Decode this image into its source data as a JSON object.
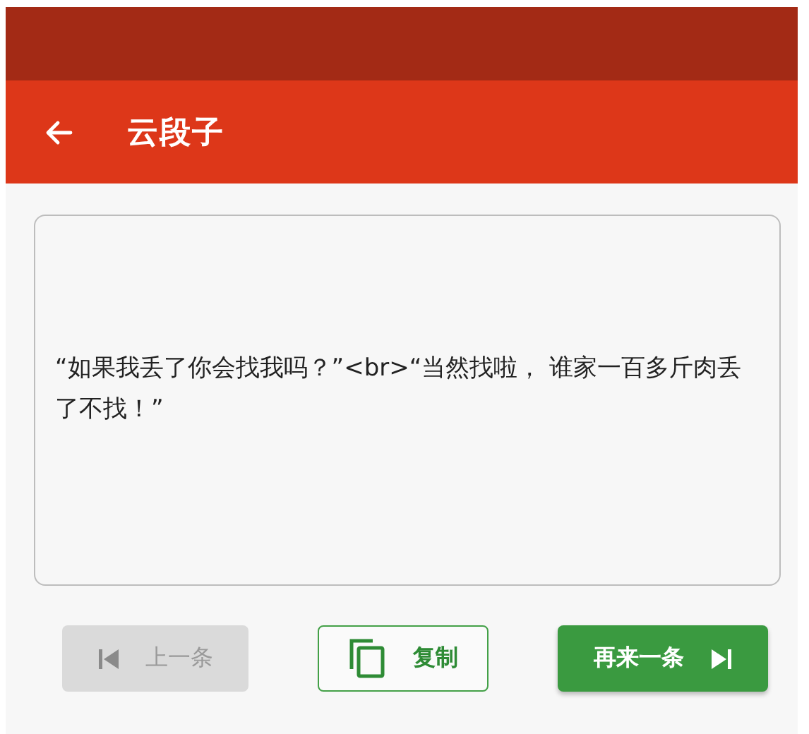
{
  "app_bar": {
    "title": "云段子"
  },
  "joke": {
    "text": "“如果我丢了你会找我吗？”<br>“当然找啦， 谁家一百多斤肉丢了不找！”"
  },
  "buttons": [
    {
      "kind": "previous",
      "label": "上一条",
      "disabled": true
    },
    {
      "kind": "copy",
      "label": "复制",
      "disabled": false
    },
    {
      "kind": "next",
      "label": "再来一条",
      "disabled": false
    }
  ]
}
